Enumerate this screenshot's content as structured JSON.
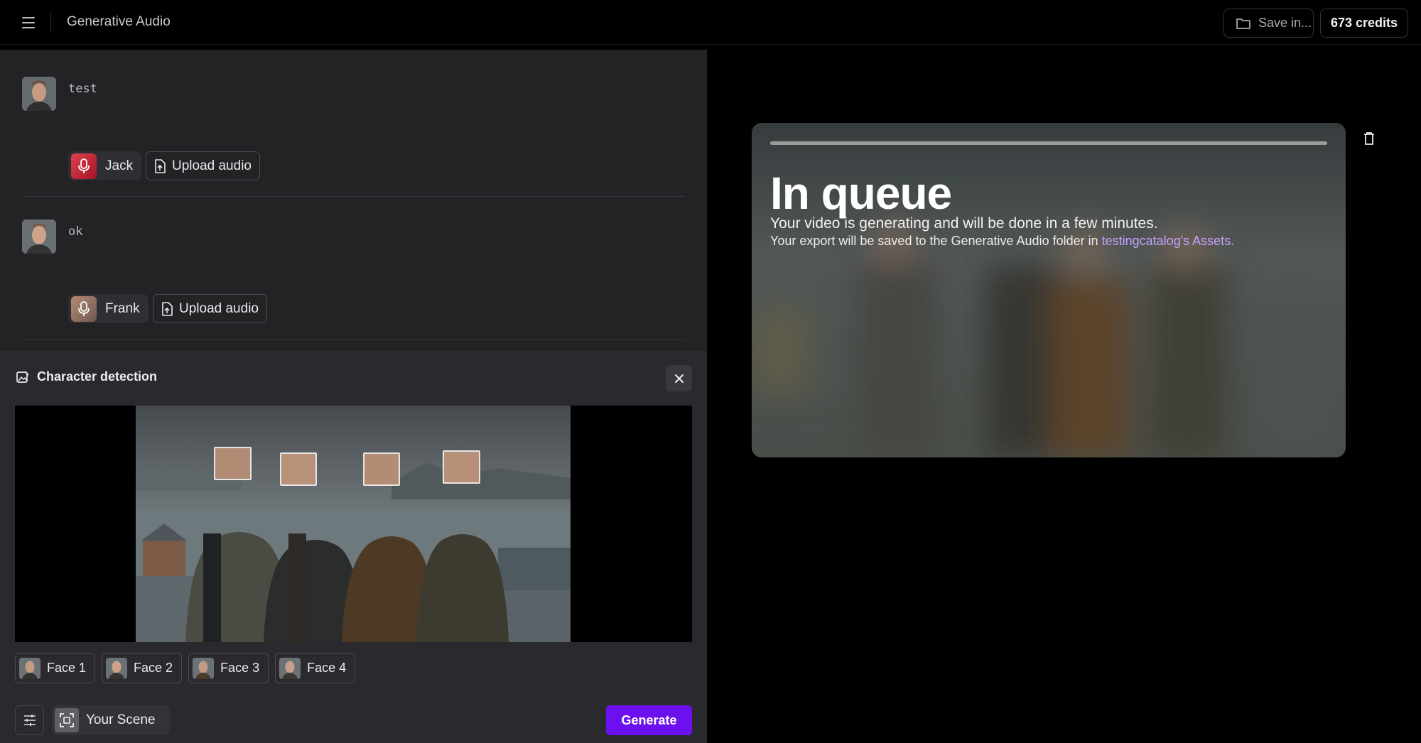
{
  "header": {
    "app_title": "Generative Audio",
    "save_label": "Save in...",
    "credits_label": "673 credits"
  },
  "script_lines": [
    {
      "text": "test",
      "voice": "Jack",
      "upload_label": "Upload audio"
    },
    {
      "text": "ok",
      "voice": "Frank",
      "upload_label": "Upload audio"
    }
  ],
  "character_detection": {
    "title": "Character detection",
    "faces": [
      "Face 1",
      "Face 2",
      "Face 3",
      "Face 4"
    ],
    "scene_label": "Your Scene",
    "generate_label": "Generate"
  },
  "queue": {
    "title": "In queue",
    "message": "Your video is generating and will be done in a few minutes.",
    "note_prefix": "Your export will be saved to the Generative Audio folder in ",
    "note_link": "testingcatalog's Assets",
    "note_suffix": "."
  },
  "colors": {
    "accent": "#6d10f0",
    "link": "#c6a2ff",
    "mic_jack": "#c8243a",
    "mic_frank": "#8c6a5a"
  },
  "icons": {
    "menu": "menu-icon",
    "folder": "folder-icon",
    "mic": "microphone-icon",
    "upload": "file-upload-icon",
    "image_edit": "image-edit-icon",
    "close": "close-icon",
    "sliders": "sliders-icon",
    "scan": "face-scan-icon",
    "trash": "trash-icon"
  }
}
